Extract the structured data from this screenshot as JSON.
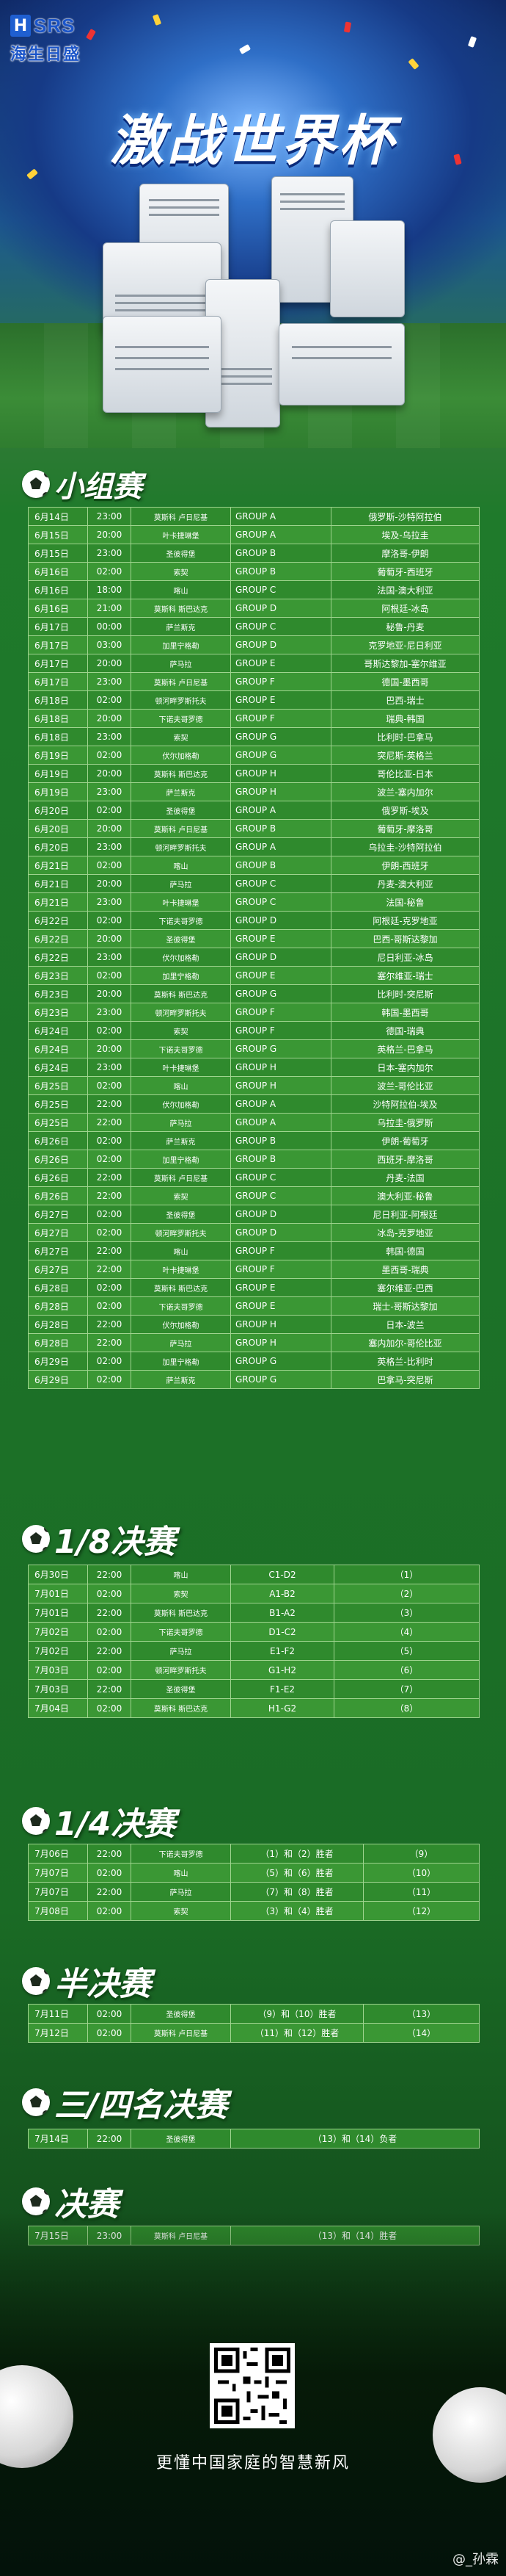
{
  "header": {
    "logo_mark": "SRS",
    "logo_cn": "海生日盛",
    "title": "激战世界杯"
  },
  "colors": {
    "background_green": "#1f7a2b",
    "row_green": "#2f8a2d",
    "row_green_alt": "#3a9734",
    "grid_line": "#9fd48f",
    "logo_blue": "#1b55c9"
  },
  "sections": {
    "group": "小组赛",
    "r16": "1/8决赛",
    "qf": "1/4决赛",
    "sf": "半决赛",
    "third": "三/四名决赛",
    "final": "决赛"
  },
  "group_matches": [
    [
      "6月14日",
      "23:00",
      "莫斯科 卢日尼基",
      "GROUP A",
      "俄罗斯-沙特阿拉伯"
    ],
    [
      "6月15日",
      "20:00",
      "叶卡捷琳堡",
      "GROUP A",
      "埃及-乌拉圭"
    ],
    [
      "6月15日",
      "23:00",
      "圣彼得堡",
      "GROUP B",
      "摩洛哥-伊朗"
    ],
    [
      "6月16日",
      "02:00",
      "索契",
      "GROUP B",
      "葡萄牙-西班牙"
    ],
    [
      "6月16日",
      "18:00",
      "喀山",
      "GROUP C",
      "法国-澳大利亚"
    ],
    [
      "6月16日",
      "21:00",
      "莫斯科 斯巴达克",
      "GROUP D",
      "阿根廷-冰岛"
    ],
    [
      "6月17日",
      "00:00",
      "萨兰斯克",
      "GROUP C",
      "秘鲁-丹麦"
    ],
    [
      "6月17日",
      "03:00",
      "加里宁格勒",
      "GROUP D",
      "克罗地亚-尼日利亚"
    ],
    [
      "6月17日",
      "20:00",
      "萨马拉",
      "GROUP E",
      "哥斯达黎加-塞尔维亚"
    ],
    [
      "6月17日",
      "23:00",
      "莫斯科 卢日尼基",
      "GROUP F",
      "德国-墨西哥"
    ],
    [
      "6月18日",
      "02:00",
      "顿河畔罗斯托夫",
      "GROUP E",
      "巴西-瑞士"
    ],
    [
      "6月18日",
      "20:00",
      "下诺夫哥罗德",
      "GROUP F",
      "瑞典-韩国"
    ],
    [
      "6月18日",
      "23:00",
      "索契",
      "GROUP G",
      "比利时-巴拿马"
    ],
    [
      "6月19日",
      "02:00",
      "伏尔加格勒",
      "GROUP G",
      "突尼斯-英格兰"
    ],
    [
      "6月19日",
      "20:00",
      "莫斯科 斯巴达克",
      "GROUP H",
      "哥伦比亚-日本"
    ],
    [
      "6月19日",
      "23:00",
      "萨兰斯克",
      "GROUP H",
      "波兰-塞内加尔"
    ],
    [
      "6月20日",
      "02:00",
      "圣彼得堡",
      "GROUP A",
      "俄罗斯-埃及"
    ],
    [
      "6月20日",
      "20:00",
      "莫斯科 卢日尼基",
      "GROUP B",
      "葡萄牙-摩洛哥"
    ],
    [
      "6月20日",
      "23:00",
      "顿河畔罗斯托夫",
      "GROUP A",
      "乌拉圭-沙特阿拉伯"
    ],
    [
      "6月21日",
      "02:00",
      "喀山",
      "GROUP B",
      "伊朗-西班牙"
    ],
    [
      "6月21日",
      "20:00",
      "萨马拉",
      "GROUP C",
      "丹麦-澳大利亚"
    ],
    [
      "6月21日",
      "23:00",
      "叶卡捷琳堡",
      "GROUP C",
      "法国-秘鲁"
    ],
    [
      "6月22日",
      "02:00",
      "下诺夫哥罗德",
      "GROUP D",
      "阿根廷-克罗地亚"
    ],
    [
      "6月22日",
      "20:00",
      "圣彼得堡",
      "GROUP E",
      "巴西-哥斯达黎加"
    ],
    [
      "6月22日",
      "23:00",
      "伏尔加格勒",
      "GROUP D",
      "尼日利亚-冰岛"
    ],
    [
      "6月23日",
      "02:00",
      "加里宁格勒",
      "GROUP E",
      "塞尔维亚-瑞士"
    ],
    [
      "6月23日",
      "20:00",
      "莫斯科 斯巴达克",
      "GROUP G",
      "比利时-突尼斯"
    ],
    [
      "6月23日",
      "23:00",
      "顿河畔罗斯托夫",
      "GROUP F",
      "韩国-墨西哥"
    ],
    [
      "6月24日",
      "02:00",
      "索契",
      "GROUP F",
      "德国-瑞典"
    ],
    [
      "6月24日",
      "20:00",
      "下诺夫哥罗德",
      "GROUP G",
      "英格兰-巴拿马"
    ],
    [
      "6月24日",
      "23:00",
      "叶卡捷琳堡",
      "GROUP H",
      "日本-塞内加尔"
    ],
    [
      "6月25日",
      "02:00",
      "喀山",
      "GROUP H",
      "波兰-哥伦比亚"
    ],
    [
      "6月25日",
      "22:00",
      "伏尔加格勒",
      "GROUP A",
      "沙特阿拉伯-埃及"
    ],
    [
      "6月25日",
      "22:00",
      "萨马拉",
      "GROUP A",
      "乌拉圭-俄罗斯"
    ],
    [
      "6月26日",
      "02:00",
      "萨兰斯克",
      "GROUP B",
      "伊朗-葡萄牙"
    ],
    [
      "6月26日",
      "02:00",
      "加里宁格勒",
      "GROUP B",
      "西班牙-摩洛哥"
    ],
    [
      "6月26日",
      "22:00",
      "莫斯科 卢日尼基",
      "GROUP C",
      "丹麦-法国"
    ],
    [
      "6月26日",
      "22:00",
      "索契",
      "GROUP C",
      "澳大利亚-秘鲁"
    ],
    [
      "6月27日",
      "02:00",
      "圣彼得堡",
      "GROUP D",
      "尼日利亚-阿根廷"
    ],
    [
      "6月27日",
      "02:00",
      "顿河畔罗斯托夫",
      "GROUP D",
      "冰岛-克罗地亚"
    ],
    [
      "6月27日",
      "22:00",
      "喀山",
      "GROUP F",
      "韩国-德国"
    ],
    [
      "6月27日",
      "22:00",
      "叶卡捷琳堡",
      "GROUP F",
      "墨西哥-瑞典"
    ],
    [
      "6月28日",
      "02:00",
      "莫斯科 斯巴达克",
      "GROUP E",
      "塞尔维亚-巴西"
    ],
    [
      "6月28日",
      "02:00",
      "下诺夫哥罗德",
      "GROUP E",
      "瑞士-哥斯达黎加"
    ],
    [
      "6月28日",
      "22:00",
      "伏尔加格勒",
      "GROUP H",
      "日本-波兰"
    ],
    [
      "6月28日",
      "22:00",
      "萨马拉",
      "GROUP H",
      "塞内加尔-哥伦比亚"
    ],
    [
      "6月29日",
      "02:00",
      "加里宁格勒",
      "GROUP G",
      "英格兰-比利时"
    ],
    [
      "6月29日",
      "02:00",
      "萨兰斯克",
      "GROUP G",
      "巴拿马-突尼斯"
    ]
  ],
  "r16_matches": [
    [
      "6月30日",
      "22:00",
      "喀山",
      "C1-D2",
      "（1）"
    ],
    [
      "7月01日",
      "02:00",
      "索契",
      "A1-B2",
      "（2）"
    ],
    [
      "7月01日",
      "22:00",
      "莫斯科 斯巴达克",
      "B1-A2",
      "（3）"
    ],
    [
      "7月02日",
      "02:00",
      "下诺夫哥罗德",
      "D1-C2",
      "（4）"
    ],
    [
      "7月02日",
      "22:00",
      "萨马拉",
      "E1-F2",
      "（5）"
    ],
    [
      "7月03日",
      "02:00",
      "顿河畔罗斯托夫",
      "G1-H2",
      "（6）"
    ],
    [
      "7月03日",
      "22:00",
      "圣彼得堡",
      "F1-E2",
      "（7）"
    ],
    [
      "7月04日",
      "02:00",
      "莫斯科 斯巴达克",
      "H1-G2",
      "（8）"
    ]
  ],
  "qf_matches": [
    [
      "7月06日",
      "22:00",
      "下诺夫哥罗德",
      "（1）和（2）胜者",
      "（9）"
    ],
    [
      "7月07日",
      "02:00",
      "喀山",
      "（5）和（6）胜者",
      "（10）"
    ],
    [
      "7月07日",
      "22:00",
      "萨马拉",
      "（7）和（8）胜者",
      "（11）"
    ],
    [
      "7月08日",
      "02:00",
      "索契",
      "（3）和（4）胜者",
      "（12）"
    ]
  ],
  "sf_matches": [
    [
      "7月11日",
      "02:00",
      "圣彼得堡",
      "（9）和（10）胜者",
      "（13）"
    ],
    [
      "7月12日",
      "02:00",
      "莫斯科 卢日尼基",
      "（11）和（12）胜者",
      "（14）"
    ]
  ],
  "third_match": [
    "7月14日",
    "22:00",
    "圣彼得堡",
    "（13）和（14）负者"
  ],
  "final_match": [
    "7月15日",
    "23:00",
    "莫斯科 卢日尼基",
    "（13）和（14）胜者"
  ],
  "footer": {
    "slogan": "更懂中国家庭的智慧新风",
    "watermark": "@_孙霖"
  }
}
